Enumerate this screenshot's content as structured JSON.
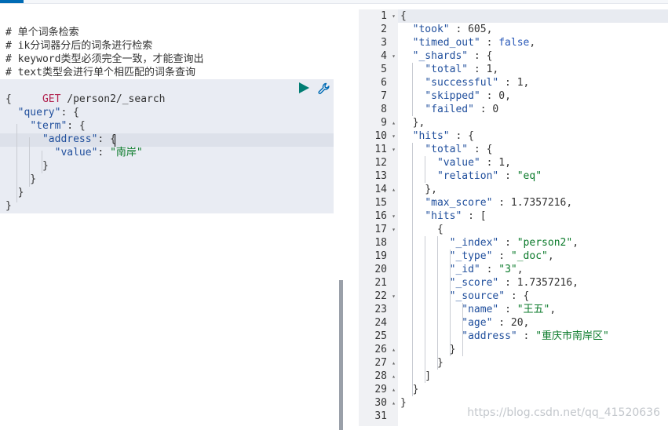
{
  "left": {
    "comments": [
      "# 单个词条检索",
      "# ik分词器分后的词条进行检索",
      "# keyword类型必须完全一致，才能查询出",
      "# text类型会进行单个相匹配的词条查询"
    ],
    "method": "GET",
    "path": "/person2/_search",
    "body": [
      "{",
      "  \"query\": {",
      "    \"term\": {",
      "      \"address\": {",
      "        \"value\": \"南岸\"",
      "      }",
      "    }",
      "  }",
      "}"
    ],
    "run_icon": "play-icon",
    "wrench_icon": "wrench-icon"
  },
  "right": {
    "line_numbers": [
      "1",
      "2",
      "3",
      "4",
      "5",
      "6",
      "7",
      "8",
      "9",
      "10",
      "11",
      "12",
      "13",
      "14",
      "15",
      "16",
      "17",
      "18",
      "19",
      "20",
      "21",
      "22",
      "23",
      "24",
      "25",
      "26",
      "27",
      "28",
      "29",
      "30",
      "31"
    ],
    "fold_markers": {
      "1": "▾",
      "4": "▾",
      "9": "▴",
      "10": "▾",
      "11": "▾",
      "14": "▴",
      "16": "▾",
      "17": "▾",
      "22": "▾",
      "26": "▴",
      "27": "▴",
      "28": "▴",
      "29": "▴",
      "30": "▴"
    },
    "lines": [
      "{",
      "  \"took\" : 605,",
      "  \"timed_out\" : false,",
      "  \"_shards\" : {",
      "    \"total\" : 1,",
      "    \"successful\" : 1,",
      "    \"skipped\" : 0,",
      "    \"failed\" : 0",
      "  },",
      "  \"hits\" : {",
      "    \"total\" : {",
      "      \"value\" : 1,",
      "      \"relation\" : \"eq\"",
      "    },",
      "    \"max_score\" : 1.7357216,",
      "    \"hits\" : [",
      "      {",
      "        \"_index\" : \"person2\",",
      "        \"_type\" : \"_doc\",",
      "        \"_id\" : \"3\",",
      "        \"_score\" : 1.7357216,",
      "        \"_source\" : {",
      "          \"name\" : \"王五\",",
      "          \"age\" : 20,",
      "          \"address\" : \"重庆市南岸区\"",
      "        }",
      "      }",
      "    ]",
      "  }",
      "}",
      ""
    ]
  },
  "watermark": "https://blog.csdn.net/qq_41520636"
}
